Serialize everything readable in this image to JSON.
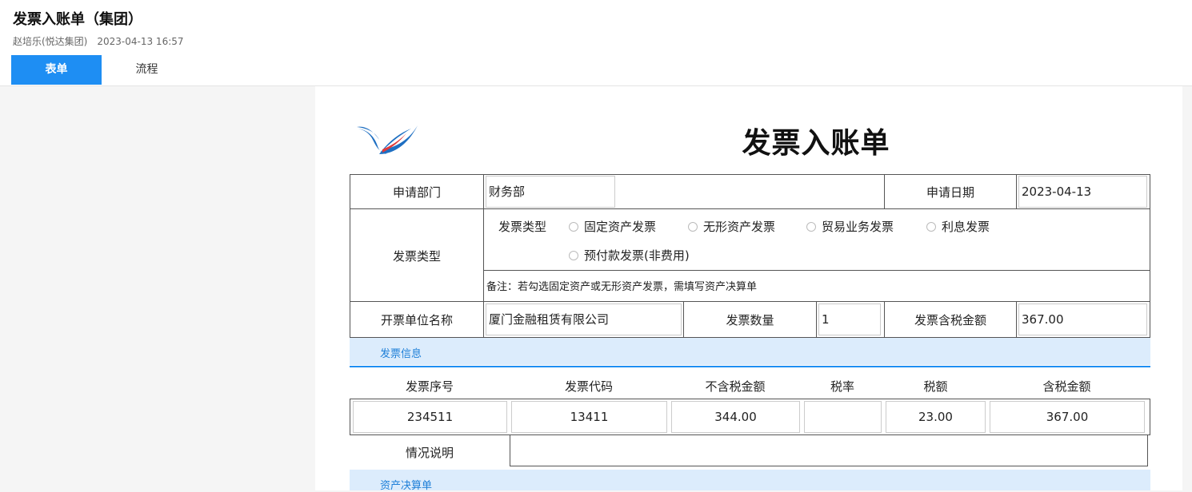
{
  "page": {
    "title": "发票入账单（集团）",
    "author": "赵培乐(悦达集团)",
    "datetime": "2023-04-13 16:57"
  },
  "tabs": [
    {
      "label": "表单",
      "active": true
    },
    {
      "label": "流程",
      "active": false
    }
  ],
  "form": {
    "logo": "company-logo",
    "title": "发票入账单",
    "apply_dept_label": "申请部门",
    "apply_dept_value": "财务部",
    "apply_date_label": "申请日期",
    "apply_date_value": "2023-04-13",
    "invoice_type_label": "发票类型",
    "invoice_type_inner_label": "发票类型",
    "invoice_type_options": [
      "固定资产发票",
      "无形资产发票",
      "贸易业务发票",
      "利息发票",
      "预付款发票(非费用)"
    ],
    "note": "备注：若勾选固定资产或无形资产发票，需填写资产决算单",
    "issuer_label": "开票单位名称",
    "issuer_value": "厦门金融租赁有限公司",
    "invoice_count_label": "发票数量",
    "invoice_count_value": "1",
    "invoice_total_label": "发票含税金额",
    "invoice_total_value": "367.00"
  },
  "invoice_info": {
    "section_title": "发票信息",
    "columns": [
      "发票序号",
      "发票代码",
      "不含税金额",
      "税率",
      "税额",
      "含税金额"
    ],
    "rows": [
      [
        "234511",
        "13411",
        "344.00",
        "",
        "23.00",
        "367.00"
      ]
    ],
    "remark_label": "情况说明",
    "remark_value": ""
  },
  "asset_section": {
    "section_title": "资产决算单"
  },
  "colors": {
    "accent": "#1e8ef3",
    "section_bg": "#dcecfc",
    "section_text": "#1e7fd8",
    "logo_blue": "#1e6fc2"
  }
}
